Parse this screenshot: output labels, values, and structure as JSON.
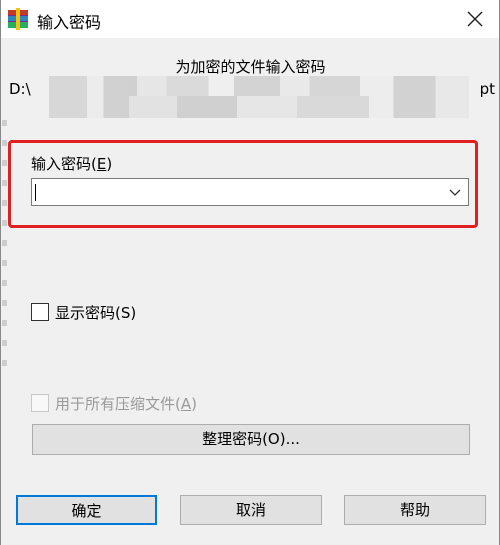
{
  "window": {
    "title": "输入密码",
    "icon": "winrar-icon",
    "close_icon": "close-icon"
  },
  "prompt": "为加密的文件输入密码",
  "file_path": {
    "prefix": "D:\\",
    "suffix": "pt"
  },
  "password": {
    "label": "输入密码(",
    "label_accel": "E",
    "label_end": ")",
    "value": "",
    "dropdown_icon": "chevron-down-icon"
  },
  "options": {
    "show_password_label": "显示密码(S)",
    "show_password_checked": false,
    "use_for_all_label_pre": "用于所有压缩文件(",
    "use_for_all_accel": "A",
    "use_for_all_label_end": ")",
    "use_for_all_checked": false,
    "use_for_all_enabled": false
  },
  "buttons": {
    "organize": "整理密码(O)...",
    "ok": "确定",
    "cancel": "取消",
    "help": "帮助"
  },
  "colors": {
    "highlight_frame": "#e02020",
    "default_button_border": "#0078d7"
  }
}
